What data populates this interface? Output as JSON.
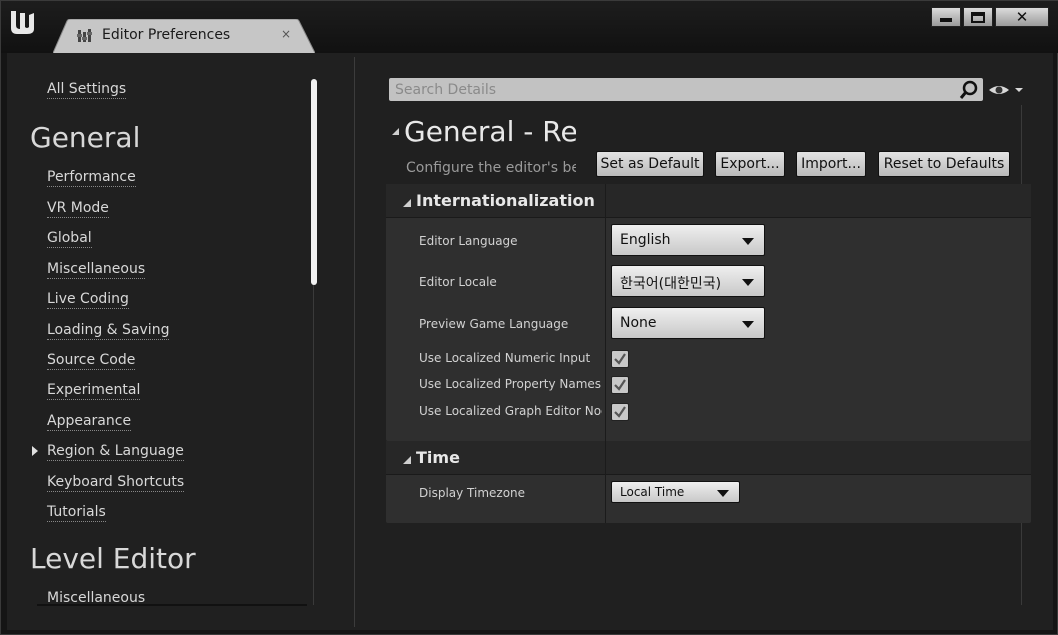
{
  "window": {
    "tab_title": "Editor Preferences",
    "tab_close": "×",
    "buttons": {
      "close_glyph": "✕"
    }
  },
  "sidebar": {
    "all_settings": "All Settings",
    "sections": [
      {
        "title": "General",
        "items": [
          "Performance",
          "VR Mode",
          "Global",
          "Miscellaneous",
          "Live Coding",
          "Loading & Saving",
          "Source Code",
          "Experimental",
          "Appearance",
          "Region & Language",
          "Keyboard Shortcuts",
          "Tutorials"
        ]
      },
      {
        "title": "Level Editor",
        "items": [
          "Miscellaneous"
        ]
      }
    ],
    "selected_item": "Region & Language"
  },
  "details": {
    "search_placeholder": "Search Details",
    "title": "General - Region & Language",
    "description": "Configure the editor's behavior to use a language and fit a region's culture.",
    "actions": {
      "set_default": "Set as Default",
      "export": "Export...",
      "import": "Import...",
      "reset": "Reset to Defaults"
    },
    "categories": {
      "internationalization": {
        "title": "Internationalization",
        "editor_language": {
          "label": "Editor Language",
          "value": "English"
        },
        "editor_locale": {
          "label": "Editor Locale",
          "value": "한국어(대한민국)"
        },
        "preview_game_language": {
          "label": "Preview Game Language",
          "value": "None"
        },
        "localized_numeric": {
          "label": "Use Localized Numeric Input",
          "checked": true
        },
        "localized_property_names": {
          "label": "Use Localized Property Names",
          "checked": true
        },
        "localized_graph_nodes": {
          "label": "Use Localized Graph Editor Nodes",
          "checked": true
        }
      },
      "time": {
        "title": "Time",
        "display_timezone": {
          "label": "Display Timezone",
          "value": "Local Time"
        }
      }
    }
  },
  "colors": {
    "background": "#202020",
    "panel": "#2f2f2f",
    "header": "#272727",
    "button": "#d0d0d0"
  }
}
